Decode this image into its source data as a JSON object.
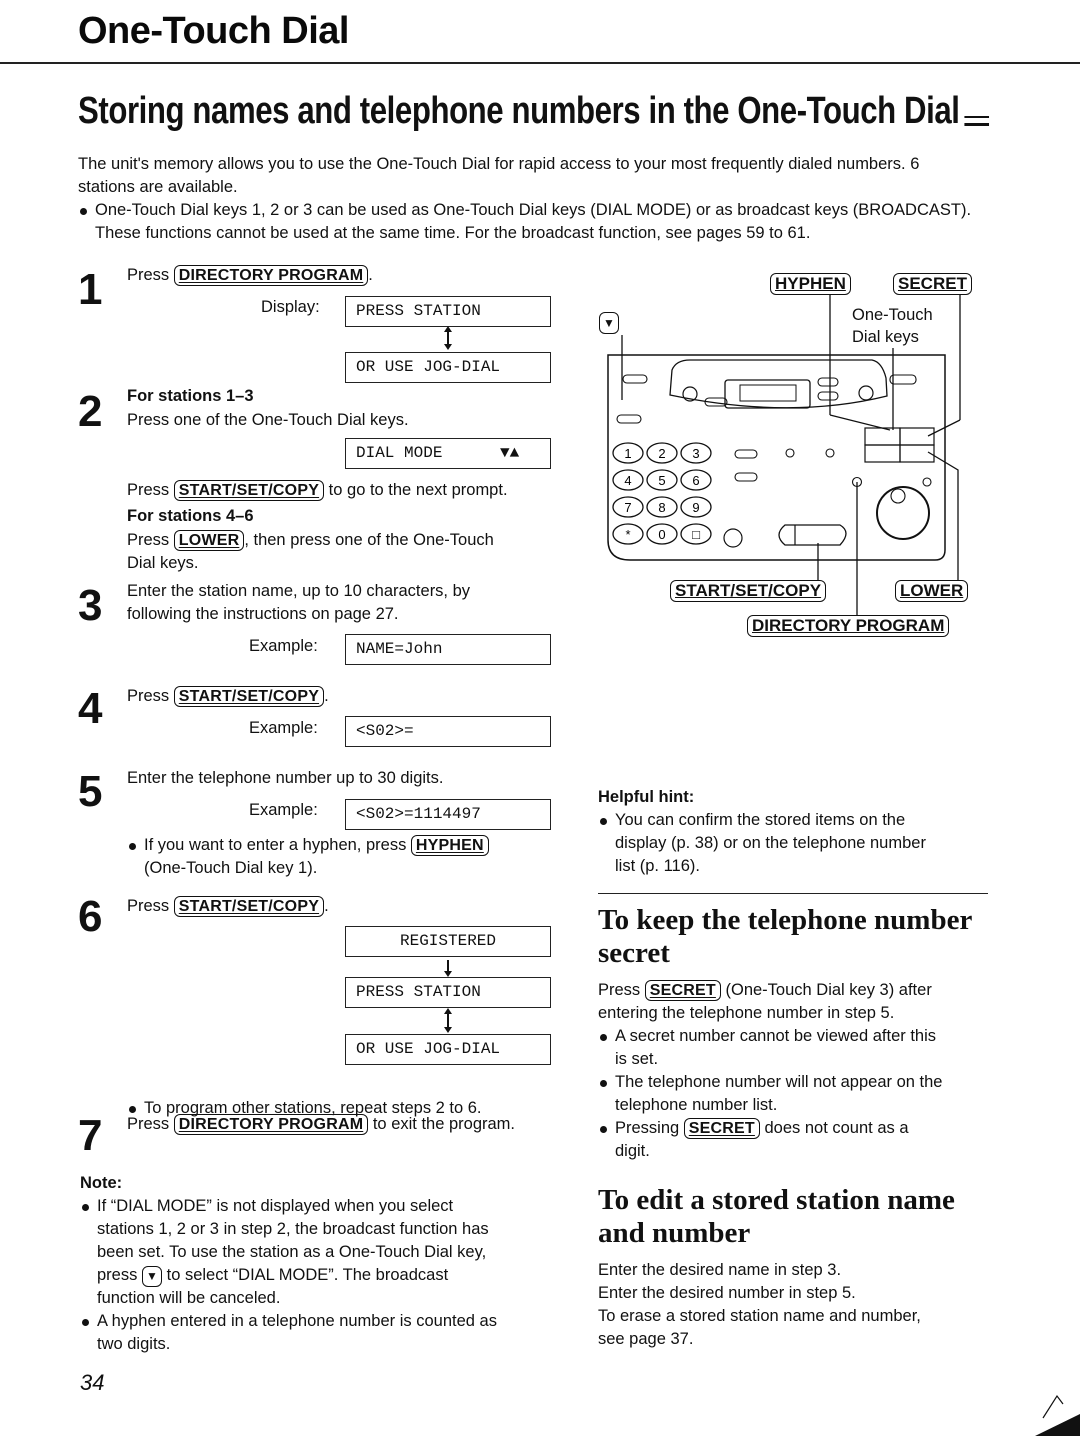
{
  "header": {
    "page_title": "One-Touch Dial",
    "section_title": "Storing names and telephone numbers in the One-Touch Dial"
  },
  "intro": {
    "paragraph": "The unit's memory allows you to use the One-Touch Dial for rapid access to your most frequently dialed numbers. 6 stations are available.",
    "bullet": "One-Touch Dial keys 1, 2 or 3 can be used as One-Touch Dial keys (DIAL MODE) or as broadcast keys (BROADCAST). These functions cannot be used at the same time. For the broadcast function, see pages 59 to 61."
  },
  "keys": {
    "directory_program": "DIRECTORY PROGRAM",
    "start_set_copy": "START/SET/COPY",
    "lower": "LOWER",
    "hyphen": "HYPHEN",
    "secret": "SECRET",
    "down_arrow": "▼"
  },
  "steps": [
    {
      "number": "1",
      "press": "Press",
      "after": ".",
      "display_label": "Display:",
      "lcd": [
        "PRESS STATION",
        "OR USE JOG-DIAL"
      ]
    },
    {
      "number": "2",
      "subhead_a": "For stations 1–3",
      "text_a": "Press one of the One-Touch Dial keys.",
      "lcd": "DIAL MODE      ▼▲",
      "press": "Press",
      "after_start": "to go to the next prompt.",
      "subhead_b": "For stations 4–6",
      "after_lower_1": ", then press one of the One-Touch",
      "after_lower_2": "Dial keys."
    },
    {
      "number": "3",
      "text_1": "Enter the station name, up to 10 characters, by",
      "text_2": "following the instructions on page 27.",
      "example_label": "Example:",
      "lcd": "NAME=John"
    },
    {
      "number": "4",
      "press": "Press",
      "after": ".",
      "example_label": "Example:",
      "lcd": "<S02>="
    },
    {
      "number": "5",
      "text": "Enter the telephone number up to 30 digits.",
      "example_label": "Example:",
      "lcd": "<S02>=1114497",
      "bullet_1": "If you want to enter a hyphen, press",
      "bullet_2": "(One-Touch Dial key 1)."
    },
    {
      "number": "6",
      "press": "Press",
      "after": ".",
      "lcd": [
        "REGISTERED",
        "PRESS STATION",
        "OR USE JOG-DIAL"
      ],
      "bullet": "To program other stations, repeat steps 2 to 6."
    },
    {
      "number": "7",
      "press": "Press",
      "after": "to exit the program."
    }
  ],
  "note": {
    "heading": "Note:",
    "bullet_1_a": "If “DIAL MODE” is not displayed when you select",
    "bullet_1_b": "stations 1, 2 or 3 in step 2, the broadcast function has",
    "bullet_1_c": "been set. To use the station as a One-Touch Dial key,",
    "bullet_1_d_pre": "press",
    "bullet_1_d_post": "to select “DIAL MODE”. The broadcast",
    "bullet_1_e": "function will be canceled.",
    "bullet_2_a": "A hyphen entered in a telephone number is counted as",
    "bullet_2_b": "two digits."
  },
  "diagram": {
    "one_touch_label_1": "One-Touch",
    "one_touch_label_2": "Dial keys",
    "keypad": [
      "1",
      "2",
      "3",
      "4",
      "5",
      "6",
      "7",
      "8",
      "9",
      "*",
      "0",
      "□"
    ]
  },
  "helpful_hint": {
    "heading": "Helpful hint:",
    "bullet_1": "You can confirm the stored items on the",
    "bullet_2": "display (p. 38) or on the telephone number",
    "bullet_3": "list (p. 116)."
  },
  "secret_section": {
    "title_1": "To keep the telephone number",
    "title_2": "secret",
    "press": "Press",
    "after_secret": "(One-Touch Dial key 3) after",
    "line_2": "entering the telephone number in step 5.",
    "bullet_1a": "A secret number cannot be viewed after this",
    "bullet_1b": "is set.",
    "bullet_2a": "The telephone number will not appear on the",
    "bullet_2b": "telephone number list.",
    "bullet_3_pre": "Pressing",
    "bullet_3_post": "does not count as a",
    "bullet_3b": "digit."
  },
  "edit_section": {
    "title_1": "To edit a stored station name",
    "title_2": "and number",
    "line_1": "Enter the desired name in step 3.",
    "line_2": "Enter the desired number in step 5.",
    "line_3": "To erase a stored station name and number,",
    "line_4": "see page 37."
  },
  "footer": {
    "page_number": "34"
  }
}
